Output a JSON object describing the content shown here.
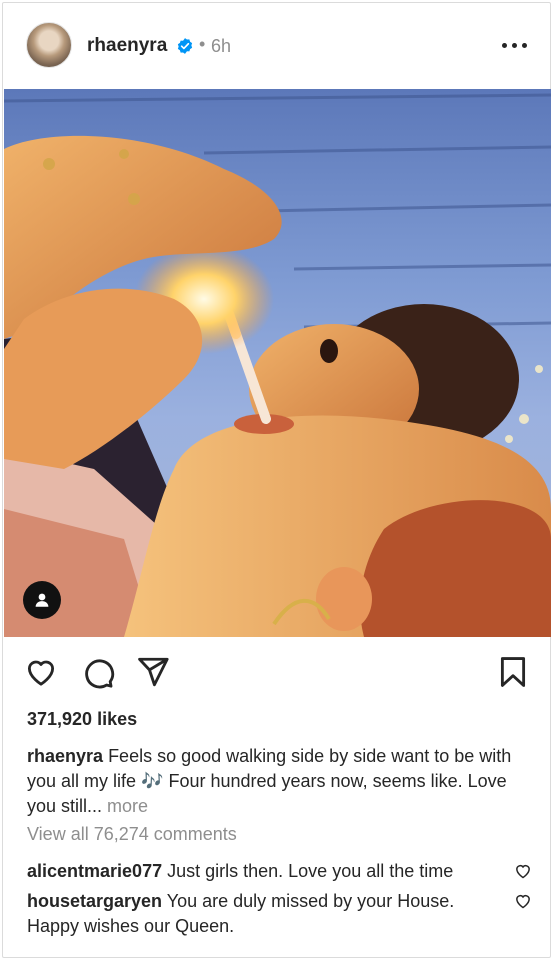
{
  "post": {
    "username": "rhaenyra",
    "separator": "•",
    "time": "6h",
    "verified": true,
    "likes": "371,920 likes",
    "caption": {
      "username": "rhaenyra",
      "text": "Feels so good walking side by side want to be with you all my life 🎶 Four hundred years now, seems like. Love you still...",
      "more": "more"
    },
    "view_all_comments": "View all 76,274 comments",
    "comments": [
      {
        "username": "alicentmarie077",
        "text": "Just girls then. Love you all the time"
      },
      {
        "username": "housetargaryen",
        "text": "You are duly missed by your House. Happy wishes our Queen."
      }
    ]
  },
  "icons": {
    "verified": "verified-badge-icon",
    "more": "more-options-icon",
    "like": "heart-icon",
    "comment": "comment-icon",
    "share": "share-icon",
    "save": "bookmark-icon",
    "tag": "user-tag-icon"
  },
  "colors": {
    "text": "#262626",
    "muted": "#8e8e8e",
    "verified": "#0095f6",
    "border": "#dbdbdb"
  }
}
